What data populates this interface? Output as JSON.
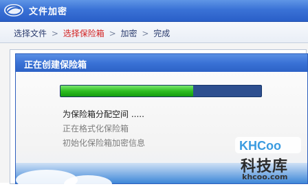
{
  "window": {
    "title": "文件加密"
  },
  "breadcrumb": {
    "steps": [
      "选择文件",
      "选择保险箱",
      "加密",
      "完成"
    ],
    "separator": ">",
    "active_color": "#d21f1f"
  },
  "dialog": {
    "title": "正在创建保险箱",
    "progress_fraction": 0.66,
    "steps": [
      "为保险箱分配空间 .....",
      "正在格式化保险箱",
      "初始化保险箱加密信息"
    ]
  },
  "watermark": {
    "badge": "KHCoo",
    "name": "科技库",
    "url": "khcoo.com"
  },
  "colors": {
    "titlebar": "#3a72d6",
    "progress_fill": "#2fbf22",
    "progress_track": "#2e4f8f"
  },
  "icons": [
    "app-logo-icon"
  ]
}
